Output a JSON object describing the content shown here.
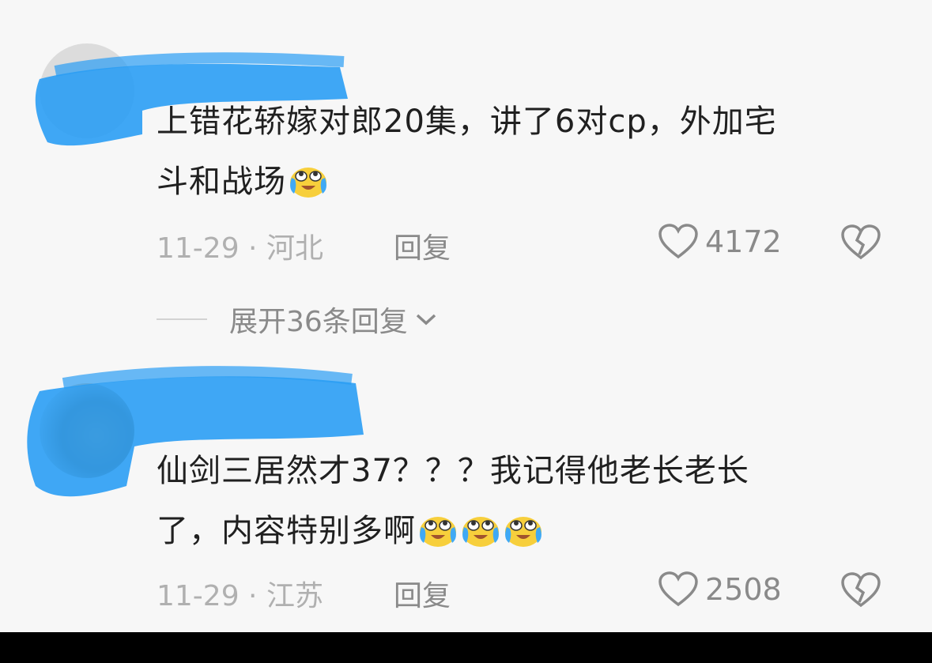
{
  "comments": [
    {
      "username": "",
      "text_line1": "上错花轿嫁对郎20集，讲了6对cp，外加宅",
      "text_line2": "斗和战场",
      "emoji_count": 1,
      "meta": "11-29 · 河北",
      "reply_label": "回复",
      "likes": "4172",
      "expand_label": "展开36条回复"
    },
    {
      "text_line1": "仙剑三居然才37？？？我记得他老长老长",
      "text_line2": "了，内容特别多啊",
      "emoji_count": 3,
      "meta": "11-29 · 江苏",
      "reply_label": "回复",
      "likes": "2508"
    }
  ],
  "colors": {
    "scribble": "#2a9df4",
    "text": "#202020",
    "meta": "#b0b0b0",
    "icon": "#8a8a8a"
  },
  "icons": [
    "heart-icon",
    "broken-heart-icon",
    "chevron-down-icon",
    "crying-laughing-emoji"
  ]
}
